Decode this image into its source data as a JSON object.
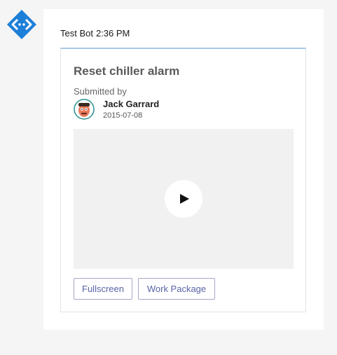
{
  "bot": {
    "icon": "bot-code-icon",
    "color": "#1e7fd9"
  },
  "message": {
    "sender": "Test Bot",
    "time": "2:36 PM"
  },
  "card": {
    "title": "Reset chiller alarm",
    "submitted_label": "Submitted by",
    "user": {
      "name": "Jack Garrard",
      "date": "2015-07-08",
      "avatar_icon": "user-avatar-icon"
    },
    "media": {
      "play_icon": "play-icon"
    },
    "actions": [
      {
        "label": "Fullscreen"
      },
      {
        "label": "Work Package"
      }
    ]
  },
  "colors": {
    "accent": "#5a64a8",
    "card_top_border": "#a7c8e8"
  }
}
